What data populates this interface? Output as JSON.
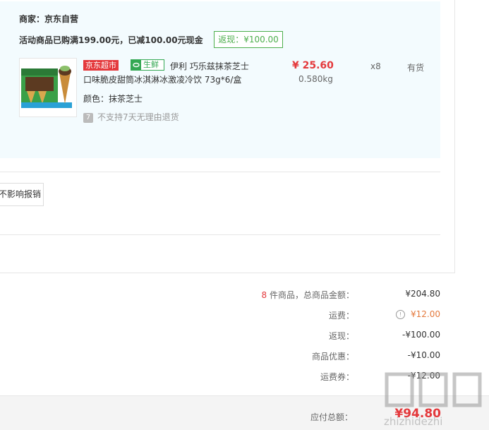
{
  "cart": {
    "merchant": "商家：京东自营",
    "promo": "活动商品已购满199.00元，已减100.00元现金",
    "rebate_tag": "返现：¥100.00",
    "item": {
      "tag_market": "京东超市",
      "tag_fresh": "生鲜",
      "title_line1": "伊利 巧乐兹抹茶芝士",
      "title_line2": "口味脆皮甜筒冰淇淋冰激凌冷饮 73g*6/盒",
      "color": "颜色：抹茶芝士",
      "no_return": "不支持7天无理由退货",
      "price": "¥ 25.60",
      "weight": "0.580kg",
      "quantity": "x8",
      "stock": "有货"
    },
    "reimburse_button": "不影响报销"
  },
  "summary": {
    "count": "8",
    "count_label": " 件商品，总商品金额：",
    "subtotal": "¥204.80",
    "shipping_label": "运费：",
    "shipping": "¥12.00",
    "cashback_label": "返现：",
    "cashback": "-¥100.00",
    "discount_label": "商品优惠：",
    "discount": "-¥10.00",
    "coupon_label": "运费券：",
    "coupon": "-¥12.00",
    "total_label": "应付总额：",
    "total": "¥94.80"
  },
  "watermark": "zhizhidezhi",
  "colors": {
    "accent_red": "#e4393c",
    "fresh_green": "#34a853",
    "panel_blue": "#f3fbfe",
    "shipping_orange": "#e4793c"
  }
}
